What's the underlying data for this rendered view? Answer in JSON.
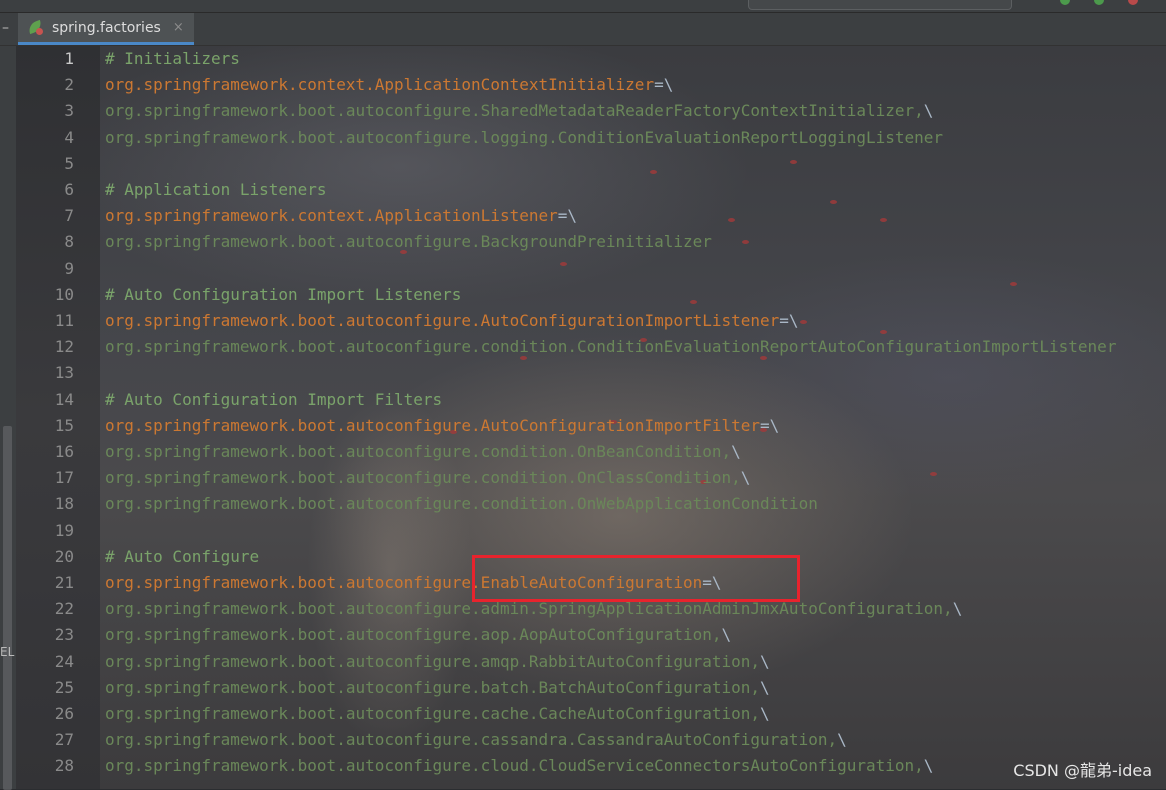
{
  "tab": {
    "label": "spring.factories",
    "close": "×"
  },
  "sidebar": {
    "label": "EL"
  },
  "watermark": "CSDN @龍弟-idea",
  "colors": {
    "comment": "#7aa36a",
    "key": "#cc7832",
    "value": "#6a8759",
    "highlight": "#e8232d"
  },
  "lines": [
    {
      "n": "1",
      "type": "comment",
      "text": "# Initializers"
    },
    {
      "n": "2",
      "type": "key",
      "text": "org.springframework.context.ApplicationContextInitializer",
      "suffix": "=\\"
    },
    {
      "n": "3",
      "type": "value",
      "text": "org.springframework.boot.autoconfigure.SharedMetadataReaderFactoryContextInitializer,",
      "suffix": "\\"
    },
    {
      "n": "4",
      "type": "value",
      "text": "org.springframework.boot.autoconfigure.logging.ConditionEvaluationReportLoggingListener",
      "suffix": ""
    },
    {
      "n": "5",
      "type": "blank",
      "text": ""
    },
    {
      "n": "6",
      "type": "comment",
      "text": "# Application Listeners"
    },
    {
      "n": "7",
      "type": "key",
      "text": "org.springframework.context.ApplicationListener",
      "suffix": "=\\"
    },
    {
      "n": "8",
      "type": "value",
      "text": "org.springframework.boot.autoconfigure.BackgroundPreinitializer",
      "suffix": ""
    },
    {
      "n": "9",
      "type": "blank",
      "text": ""
    },
    {
      "n": "10",
      "type": "comment",
      "text": "# Auto Configuration Import Listeners"
    },
    {
      "n": "11",
      "type": "key",
      "text": "org.springframework.boot.autoconfigure.AutoConfigurationImportListener",
      "suffix": "=\\"
    },
    {
      "n": "12",
      "type": "value",
      "text": "org.springframework.boot.autoconfigure.condition.ConditionEvaluationReportAutoConfigurationImportListener",
      "suffix": ""
    },
    {
      "n": "13",
      "type": "blank",
      "text": ""
    },
    {
      "n": "14",
      "type": "comment",
      "text": "# Auto Configuration Import Filters"
    },
    {
      "n": "15",
      "type": "key",
      "text": "org.springframework.boot.autoconfigure.AutoConfigurationImportFilter",
      "suffix": "=\\"
    },
    {
      "n": "16",
      "type": "value",
      "text": "org.springframework.boot.autoconfigure.condition.OnBeanCondition,",
      "suffix": "\\"
    },
    {
      "n": "17",
      "type": "value",
      "text": "org.springframework.boot.autoconfigure.condition.OnClassCondition,",
      "suffix": "\\"
    },
    {
      "n": "18",
      "type": "value",
      "text": "org.springframework.boot.autoconfigure.condition.OnWebApplicationCondition",
      "suffix": ""
    },
    {
      "n": "19",
      "type": "blank",
      "text": ""
    },
    {
      "n": "20",
      "type": "comment",
      "text": "# Auto Configure"
    },
    {
      "n": "21",
      "type": "key",
      "text": "org.springframework.boot.autoconfigure.EnableAutoConfiguration",
      "suffix": "=\\"
    },
    {
      "n": "22",
      "type": "value",
      "text": "org.springframework.boot.autoconfigure.admin.SpringApplicationAdminJmxAutoConfiguration,",
      "suffix": "\\"
    },
    {
      "n": "23",
      "type": "value",
      "text": "org.springframework.boot.autoconfigure.aop.AopAutoConfiguration,",
      "suffix": "\\"
    },
    {
      "n": "24",
      "type": "value",
      "text": "org.springframework.boot.autoconfigure.amqp.RabbitAutoConfiguration,",
      "suffix": "\\"
    },
    {
      "n": "25",
      "type": "value",
      "text": "org.springframework.boot.autoconfigure.batch.BatchAutoConfiguration,",
      "suffix": "\\"
    },
    {
      "n": "26",
      "type": "value",
      "text": "org.springframework.boot.autoconfigure.cache.CacheAutoConfiguration,",
      "suffix": "\\"
    },
    {
      "n": "27",
      "type": "value",
      "text": "org.springframework.boot.autoconfigure.cassandra.CassandraAutoConfiguration,",
      "suffix": "\\"
    },
    {
      "n": "28",
      "type": "value",
      "text": "org.springframework.boot.autoconfigure.cloud.CloudServiceConnectorsAutoConfiguration,",
      "suffix": "\\"
    }
  ]
}
